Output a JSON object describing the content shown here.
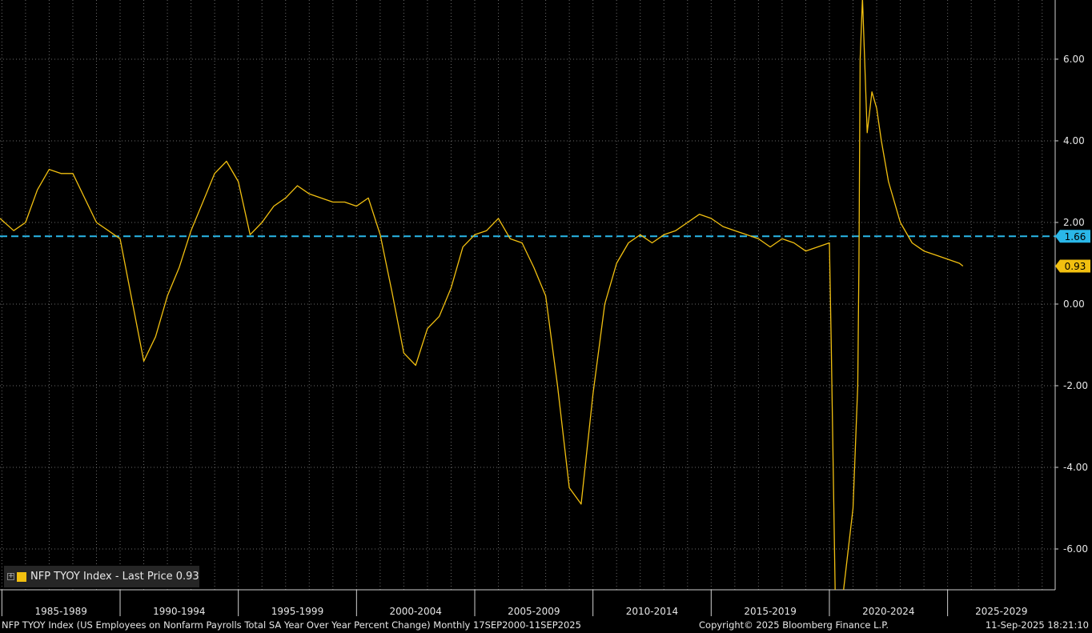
{
  "chart_data": {
    "type": "line",
    "series": [
      {
        "name": "NFP TYOY Index - Last Price",
        "color": "#f2c010",
        "x": [
          1984.92,
          1985.5,
          1986.0,
          1986.5,
          1987.0,
          1987.5,
          1988.0,
          1988.5,
          1989.0,
          1989.5,
          1990.0,
          1990.5,
          1991.0,
          1991.5,
          1992.0,
          1992.5,
          1993.0,
          1993.5,
          1994.0,
          1994.5,
          1995.0,
          1995.5,
          1996.0,
          1996.5,
          1997.0,
          1997.5,
          1998.0,
          1998.5,
          1999.0,
          1999.5,
          2000.0,
          2000.5,
          2001.0,
          2001.5,
          2002.0,
          2002.5,
          2003.0,
          2003.5,
          2004.0,
          2004.5,
          2005.0,
          2005.5,
          2006.0,
          2006.5,
          2007.0,
          2007.5,
          2008.0,
          2008.5,
          2009.0,
          2009.5,
          2010.0,
          2010.5,
          2011.0,
          2011.5,
          2012.0,
          2012.5,
          2013.0,
          2013.5,
          2014.0,
          2014.5,
          2015.0,
          2015.5,
          2016.0,
          2016.5,
          2017.0,
          2017.5,
          2018.0,
          2018.5,
          2019.0,
          2019.5,
          2020.0,
          2020.08,
          2020.25,
          2020.4,
          2020.6,
          2020.8,
          2021.0,
          2021.2,
          2021.25,
          2021.3,
          2021.4,
          2021.6,
          2021.8,
          2022.0,
          2022.2,
          2022.5,
          2023.0,
          2023.5,
          2024.0,
          2024.5,
          2025.0,
          2025.5,
          2025.65
        ],
        "values": [
          2.1,
          1.8,
          2.0,
          2.8,
          3.3,
          3.2,
          3.2,
          2.6,
          2.0,
          1.8,
          1.6,
          0.1,
          -1.4,
          -0.8,
          0.2,
          0.9,
          1.8,
          2.5,
          3.2,
          3.5,
          3.0,
          1.7,
          2.0,
          2.4,
          2.6,
          2.9,
          2.7,
          2.6,
          2.5,
          2.5,
          2.4,
          2.6,
          1.7,
          0.3,
          -1.2,
          -1.5,
          -0.6,
          -0.3,
          0.4,
          1.4,
          1.7,
          1.8,
          2.1,
          1.6,
          1.5,
          0.9,
          0.2,
          -2.0,
          -4.5,
          -4.9,
          -2.2,
          0.0,
          1.0,
          1.5,
          1.7,
          1.5,
          1.7,
          1.8,
          2.0,
          2.2,
          2.1,
          1.9,
          1.8,
          1.7,
          1.6,
          1.4,
          1.6,
          1.5,
          1.3,
          1.4,
          1.5,
          -1.0,
          -7.3,
          -8.0,
          -7.0,
          -6.0,
          -5.0,
          -2.0,
          1.0,
          6.0,
          7.5,
          4.2,
          5.2,
          4.8,
          4.0,
          3.0,
          2.0,
          1.5,
          1.3,
          1.2,
          1.1,
          1.0,
          0.93
        ]
      }
    ],
    "x_range": [
      1984.92,
      2029.55
    ],
    "ylim": [
      -7.0,
      7.45
    ],
    "yticks": [
      6.0,
      4.0,
      2.0,
      0.0,
      -2.0,
      -4.0,
      -6.0
    ],
    "ytick_labels": [
      "6.00",
      "4.00",
      "2.00",
      "0.00",
      "-2.00",
      "-4.00",
      "-6.00"
    ],
    "xticks": [
      1985,
      1990,
      1995,
      2000,
      2005,
      2010,
      2015,
      2020,
      2025,
      2030
    ],
    "xtick_labels": [
      "1985-1989",
      "1990-1994",
      "1995-1999",
      "2000-2004",
      "2005-2009",
      "2010-2014",
      "2015-2019",
      "2020-2024",
      "2025-2029"
    ],
    "reference_line": {
      "value": 1.66,
      "label": "1.66",
      "color": "#2ab7e8"
    },
    "last_value": {
      "value": 0.93,
      "label": "0.93",
      "color": "#f2c010"
    },
    "grid": true,
    "legend": {
      "placement": "bottom-left",
      "label": "NFP TYOY Index - Last Price 0.93"
    }
  },
  "footer": {
    "description": "NFP TYOY Index (US Employees on Nonfarm Payrolls Total SA Year Over Year Percent Change)  Monthly 17SEP2000-11SEP2025",
    "copyright": "Copyright© 2025 Bloomberg Finance L.P.",
    "timestamp": "11-Sep-2025 18:21:10"
  },
  "colors": {
    "background": "#000000",
    "grid": "#6a6a6a",
    "axis": "#d0d0d0"
  }
}
